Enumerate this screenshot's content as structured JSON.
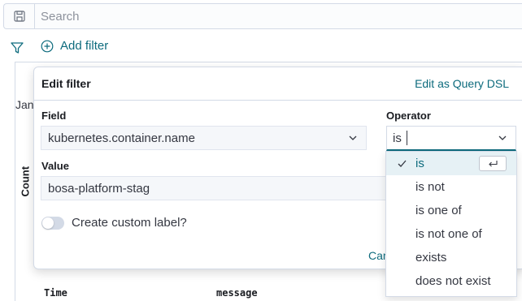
{
  "search": {
    "placeholder": "Search"
  },
  "filter_bar": {
    "add_filter_label": "Add filter"
  },
  "background": {
    "date_label": "Jan",
    "y_axis_label": "Count",
    "columns": [
      "Time",
      "message"
    ]
  },
  "edit_filter": {
    "title": "Edit filter",
    "query_dsl_link": "Edit as Query DSL",
    "field_label": "Field",
    "field_value": "kubernetes.container.name",
    "operator_label": "Operator",
    "operator_value": "is",
    "value_label": "Value",
    "value_value": "bosa-platform-stag",
    "custom_label_toggle": "Create custom label?",
    "cancel_label": "Can"
  },
  "operator_options": [
    {
      "label": "is",
      "selected": true
    },
    {
      "label": "is not",
      "selected": false
    },
    {
      "label": "is one of",
      "selected": false
    },
    {
      "label": "is not one of",
      "selected": false
    },
    {
      "label": "exists",
      "selected": false
    },
    {
      "label": "does not exist",
      "selected": false
    }
  ],
  "colors": {
    "accent": "#0d6b7d",
    "link": "#006bb8",
    "border": "#d3dae6"
  }
}
